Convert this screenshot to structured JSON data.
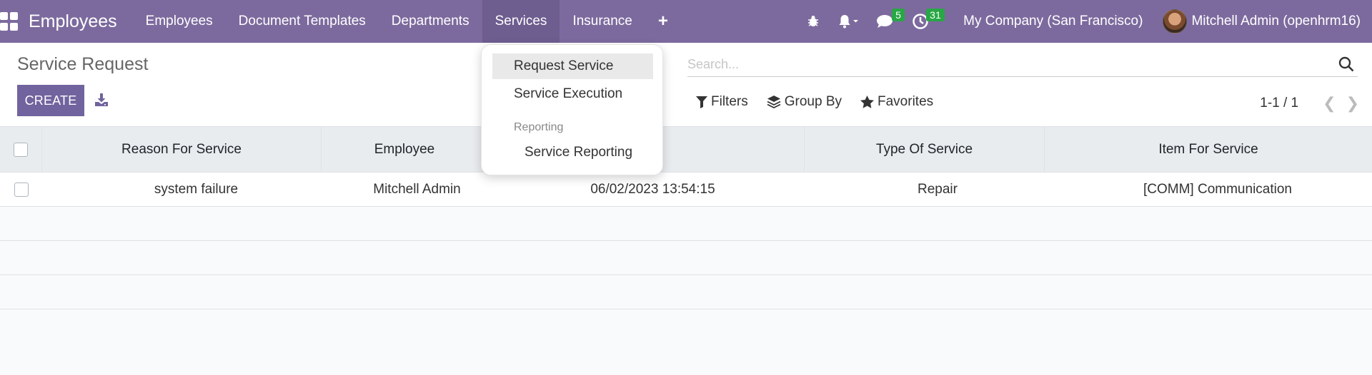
{
  "navbar": {
    "app_title": "Employees",
    "menu": [
      {
        "label": "Employees"
      },
      {
        "label": "Document Templates"
      },
      {
        "label": "Departments"
      },
      {
        "label": "Services"
      },
      {
        "label": "Insurance"
      }
    ],
    "plus_label": "+",
    "messages_count": "5",
    "activities_count": "31",
    "company": "My Company (San Francisco)",
    "user": "Mitchell Admin (openhrm16)"
  },
  "control_panel": {
    "title": "Service Request",
    "create_label": "CREATE",
    "search_placeholder": "Search...",
    "filters_label": "Filters",
    "groupby_label": "Group By",
    "favorites_label": "Favorites",
    "pager": "1-1 / 1"
  },
  "table": {
    "headers": [
      "Reason For Service",
      "Employee",
      "",
      "Type Of Service",
      "Item For Service"
    ],
    "rows": [
      {
        "reason": "system failure",
        "employee": "Mitchell Admin",
        "date": "06/02/2023 13:54:15",
        "type": "Repair",
        "item": "[COMM] Communication"
      }
    ]
  },
  "dropdown": {
    "items": [
      "Request Service",
      "Service Execution"
    ],
    "section_header": "Reporting",
    "section_items": [
      "Service Reporting"
    ]
  },
  "colors": {
    "navbar": "#7c6a9e",
    "primary_button": "#71639e",
    "badge": "#28a745"
  }
}
